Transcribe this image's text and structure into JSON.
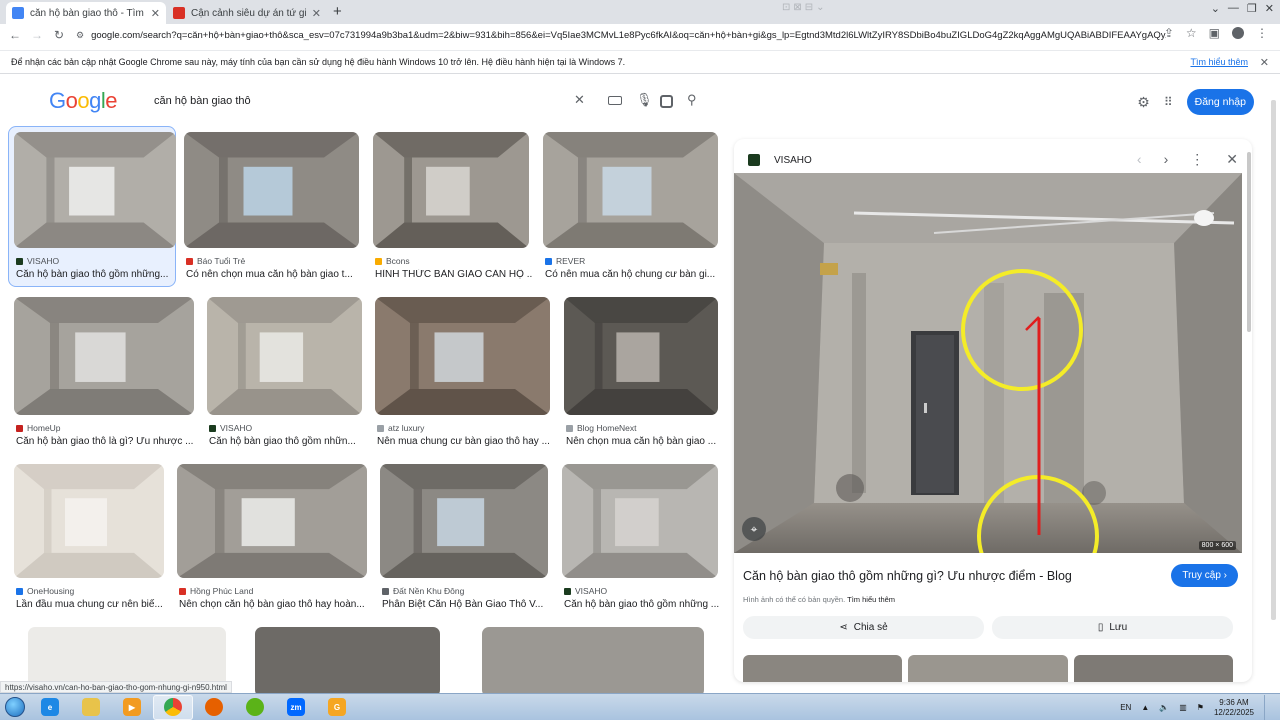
{
  "tabs": [
    {
      "title": "căn hộ bàn giao thô - Tìm trên G",
      "active": true,
      "favicon_color": "#4285f4"
    },
    {
      "title": "Cận cảnh siêu dự án tứ giác Bến",
      "active": false,
      "favicon_color": "#d93025"
    }
  ],
  "toolbar": {
    "url": "google.com/search?q=căn+hộ+bàn+giao+thô&sca_esv=07c731994a9b3ba1&udm=2&biw=931&bih=856&ei=Vq5Iae3MCMvL1e8Pyc6fkAI&oq=căn+hộ+bàn+gi&gs_lp=Egtnd3Mtd2l6LWltZyIRY8SDbiBo4buZIGLDoG4gZ2kqAggAMgUQABiABDIFEAAYgAQy..."
  },
  "infobar": {
    "message": "Để nhận các bản cập nhật Google Chrome sau này, máy tính của bạn cần sử dụng hệ điều hành Windows 10 trở lên. Hệ điều hành hiện tại là Windows 7.",
    "learn_more": "Tìm hiểu thêm"
  },
  "search": {
    "query": "căn hộ bàn giao thô",
    "logo": "Google",
    "signin": "Đăng nhập"
  },
  "results": [
    {
      "source": "VISAHO",
      "caption": "Căn hộ bàn giao thô gồm những...",
      "fav": "#1b3b1f"
    },
    {
      "source": "Báo Tuổi Trẻ",
      "caption": "Có nên chọn mua căn hộ bàn giao t...",
      "fav": "#d93025"
    },
    {
      "source": "Bcons",
      "caption": "HÌNH THỨC BÀN GIAO CĂN HỘ ...",
      "fav": "#f9ab00"
    },
    {
      "source": "REVER",
      "caption": "Có nên mua căn hộ chung cư bàn gi...",
      "fav": "#1a73e8"
    },
    {
      "source": "HomeUp",
      "caption": "Căn hộ bàn giao thô là gì? Ưu nhược ...",
      "fav": "#c5221f"
    },
    {
      "source": "VISAHO",
      "caption": "Căn hộ bàn giao thô gồm nhữn...",
      "fav": "#1b3b1f"
    },
    {
      "source": "atz luxury",
      "caption": "Nên mua chung cư bàn giao thô hay ...",
      "fav": "#9aa0a6"
    },
    {
      "source": "Blog HomeNext",
      "caption": "Nên chọn mua căn hộ bàn giao ...",
      "fav": "#9aa0a6"
    },
    {
      "source": "OneHousing",
      "caption": "Lần đầu mua chung cư nên biế...",
      "fav": "#1a73e8"
    },
    {
      "source": "Hồng Phúc Land",
      "caption": "Nên chọn căn hộ bàn giao thô hay hoàn...",
      "fav": "#d93025"
    },
    {
      "source": "Đất Nền Khu Đông",
      "caption": "Phân Biệt Căn Hộ Bàn Giao Thô V...",
      "fav": "#5f6368"
    },
    {
      "source": "VISAHO",
      "caption": "Căn hộ bàn giao thô gồm những ...",
      "fav": "#1b3b1f"
    }
  ],
  "panel": {
    "site": "VISAHO",
    "title": "Căn hộ bàn giao thô gồm những gì? Ưu nhược điểm - Blog",
    "visit": "Truy cập",
    "copyright": "Hình ảnh có thể có bản quyền.",
    "copyright_link": "Tìm hiểu thêm",
    "share": "Chia sẻ",
    "save": "Lưu",
    "dims": "800 × 600"
  },
  "status_url": "https://visaho.vn/can-ho-ban-giao-tho-gom-nhung-gi-n950.html",
  "taskbar": {
    "lang": "EN",
    "time": "9:36 AM",
    "date": "12/22/2025"
  }
}
